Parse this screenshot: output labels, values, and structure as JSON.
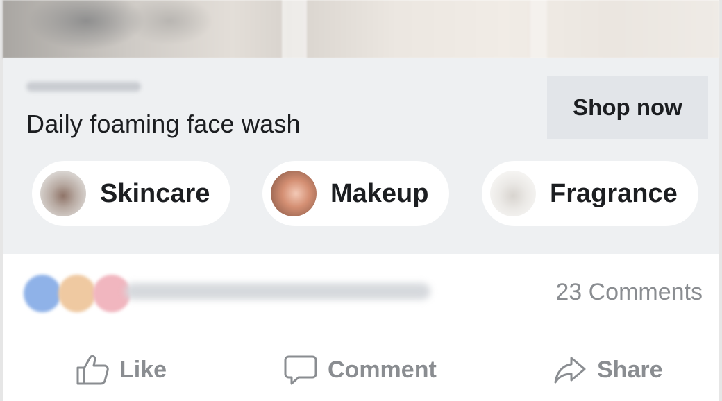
{
  "post": {
    "product_title": "Daily foaming face wash",
    "cta_label": "Shop now",
    "categories": [
      {
        "label": "Skincare",
        "icon": "skincare-thumbnail"
      },
      {
        "label": "Makeup",
        "icon": "makeup-thumbnail"
      },
      {
        "label": "Fragrance",
        "icon": "fragrance-thumbnail"
      }
    ]
  },
  "engagement": {
    "comments_label": "23 Comments",
    "reaction_colors": [
      "#8fb2e8",
      "#efc9a1",
      "#f1b6bf"
    ]
  },
  "actions": {
    "like_label": "Like",
    "comment_label": "Comment",
    "share_label": "Share"
  },
  "colors": {
    "info_background": "#eef0f2",
    "cta_background": "#e2e5e9",
    "muted_text": "#8a8d91"
  }
}
